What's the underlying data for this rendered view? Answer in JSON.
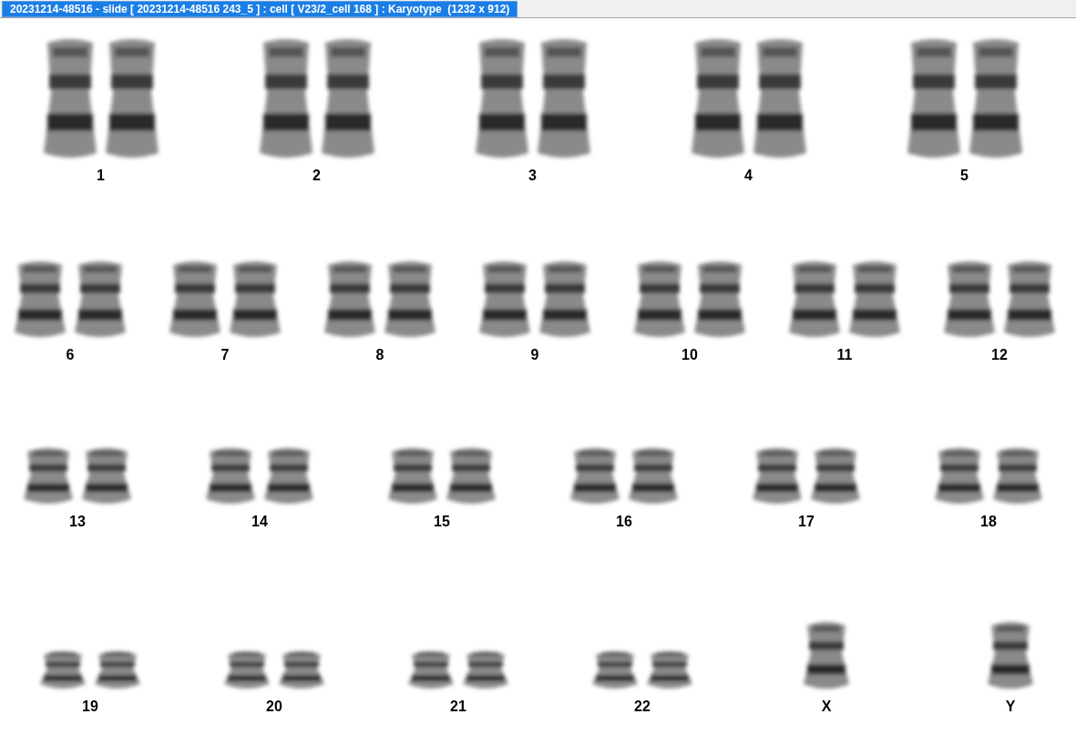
{
  "window": {
    "title": "20231214-48516 - slide [ 20231214-48516 243_5 ] : cell [ V23/2_cell 168 ] : Karyotype  (1232 x 912)"
  },
  "karyotype": {
    "rows": [
      {
        "items": [
          {
            "label": "1",
            "kind": "pair"
          },
          {
            "label": "2",
            "kind": "pair"
          },
          {
            "label": "3",
            "kind": "pair"
          },
          {
            "label": "4",
            "kind": "pair"
          },
          {
            "label": "5",
            "kind": "pair"
          }
        ]
      },
      {
        "items": [
          {
            "label": "6",
            "kind": "pair"
          },
          {
            "label": "7",
            "kind": "pair"
          },
          {
            "label": "8",
            "kind": "pair"
          },
          {
            "label": "9",
            "kind": "pair"
          },
          {
            "label": "10",
            "kind": "pair"
          },
          {
            "label": "11",
            "kind": "pair"
          },
          {
            "label": "12",
            "kind": "pair"
          }
        ]
      },
      {
        "items": [
          {
            "label": "13",
            "kind": "pair"
          },
          {
            "label": "14",
            "kind": "pair"
          },
          {
            "label": "15",
            "kind": "pair"
          },
          {
            "label": "16",
            "kind": "pair"
          },
          {
            "label": "17",
            "kind": "pair"
          },
          {
            "label": "18",
            "kind": "pair"
          }
        ]
      },
      {
        "items": [
          {
            "label": "19",
            "kind": "pair"
          },
          {
            "label": "20",
            "kind": "pair"
          },
          {
            "label": "21",
            "kind": "pair"
          },
          {
            "label": "22",
            "kind": "pair"
          },
          {
            "label": "X",
            "kind": "single"
          },
          {
            "label": "Y",
            "kind": "single"
          }
        ]
      }
    ]
  }
}
